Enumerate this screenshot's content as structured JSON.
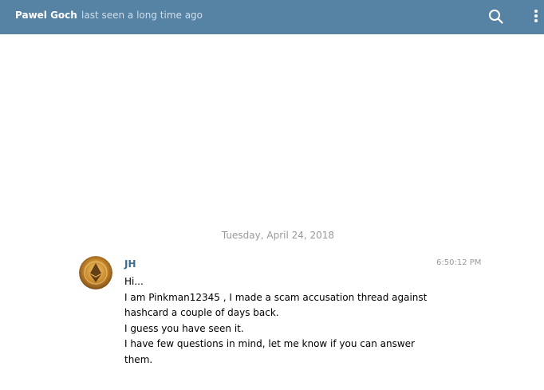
{
  "header": {
    "contact_name": "Pawel Goch",
    "status": "last seen a long time ago",
    "background_color": "#5682a3",
    "search_icon": "search-icon",
    "menu_icon": "more-vertical-icon"
  },
  "chat": {
    "date_divider": "Tuesday, April 24, 2018",
    "messages": [
      {
        "author": "JH",
        "time": "6:50:12 PM",
        "avatar_icon": "ethereum-avatar",
        "lines": [
          "Hi...",
          "I am Pinkman12345 , I made a scam accusation thread against",
          "hashcard a couple of days back.",
          "I guess you have seen it.",
          "I have few questions in mind, let me know if you can answer",
          "them."
        ]
      }
    ]
  }
}
